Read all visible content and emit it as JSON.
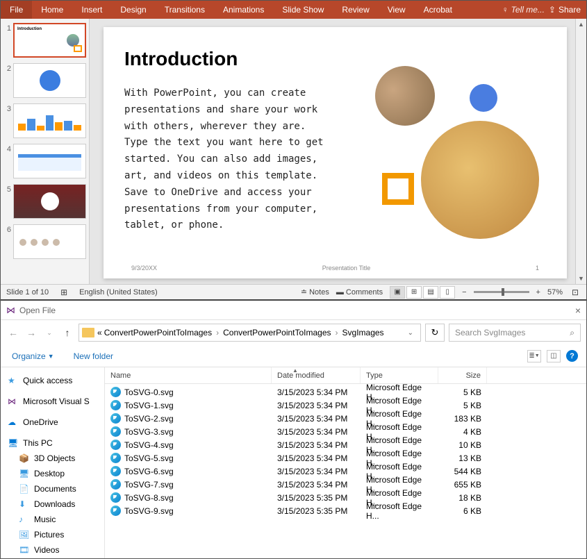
{
  "ribbon": {
    "tabs": [
      "File",
      "Home",
      "Insert",
      "Design",
      "Transitions",
      "Animations",
      "Slide Show",
      "Review",
      "View",
      "Acrobat"
    ],
    "tell_me": "Tell me...",
    "share": "Share"
  },
  "thumbnails": {
    "count": 6
  },
  "slide": {
    "title": "Introduction",
    "body": "With PowerPoint, you can create presentations and share your work with others, wherever they are. Type the text you want here to get started. You can also add images, art, and videos on this template. Save to OneDrive and access your presentations from your computer, tablet, or phone.",
    "footer_date": "9/3/20XX",
    "footer_title": "Presentation Title",
    "footer_num": "1"
  },
  "status": {
    "slide_info": "Slide 1 of 10",
    "lang": "English (United States)",
    "notes": "Notes",
    "comments": "Comments",
    "zoom": "57%"
  },
  "explorer": {
    "title": "Open File",
    "breadcrumb_prefix": "«",
    "breadcrumb": [
      "ConvertPowerPointToImages",
      "ConvertPowerPointToImages",
      "SvgImages"
    ],
    "search_placeholder": "Search SvgImages",
    "toolbar": {
      "organize": "Organize",
      "new_folder": "New folder"
    },
    "nav": {
      "quick": "Quick access",
      "vs": "Microsoft Visual S",
      "onedrive": "OneDrive",
      "thispc": "This PC",
      "items": [
        "3D Objects",
        "Desktop",
        "Documents",
        "Downloads",
        "Music",
        "Pictures",
        "Videos"
      ]
    },
    "columns": {
      "name": "Name",
      "date": "Date modified",
      "type": "Type",
      "size": "Size"
    },
    "files": [
      {
        "name": "ToSVG-0.svg",
        "date": "3/15/2023 5:34 PM",
        "type": "Microsoft Edge H...",
        "size": "5 KB"
      },
      {
        "name": "ToSVG-1.svg",
        "date": "3/15/2023 5:34 PM",
        "type": "Microsoft Edge H...",
        "size": "5 KB"
      },
      {
        "name": "ToSVG-2.svg",
        "date": "3/15/2023 5:34 PM",
        "type": "Microsoft Edge H...",
        "size": "183 KB"
      },
      {
        "name": "ToSVG-3.svg",
        "date": "3/15/2023 5:34 PM",
        "type": "Microsoft Edge H...",
        "size": "4 KB"
      },
      {
        "name": "ToSVG-4.svg",
        "date": "3/15/2023 5:34 PM",
        "type": "Microsoft Edge H...",
        "size": "10 KB"
      },
      {
        "name": "ToSVG-5.svg",
        "date": "3/15/2023 5:34 PM",
        "type": "Microsoft Edge H...",
        "size": "13 KB"
      },
      {
        "name": "ToSVG-6.svg",
        "date": "3/15/2023 5:34 PM",
        "type": "Microsoft Edge H...",
        "size": "544 KB"
      },
      {
        "name": "ToSVG-7.svg",
        "date": "3/15/2023 5:34 PM",
        "type": "Microsoft Edge H...",
        "size": "655 KB"
      },
      {
        "name": "ToSVG-8.svg",
        "date": "3/15/2023 5:35 PM",
        "type": "Microsoft Edge H...",
        "size": "18 KB"
      },
      {
        "name": "ToSVG-9.svg",
        "date": "3/15/2023 5:35 PM",
        "type": "Microsoft Edge H...",
        "size": "6 KB"
      }
    ]
  }
}
